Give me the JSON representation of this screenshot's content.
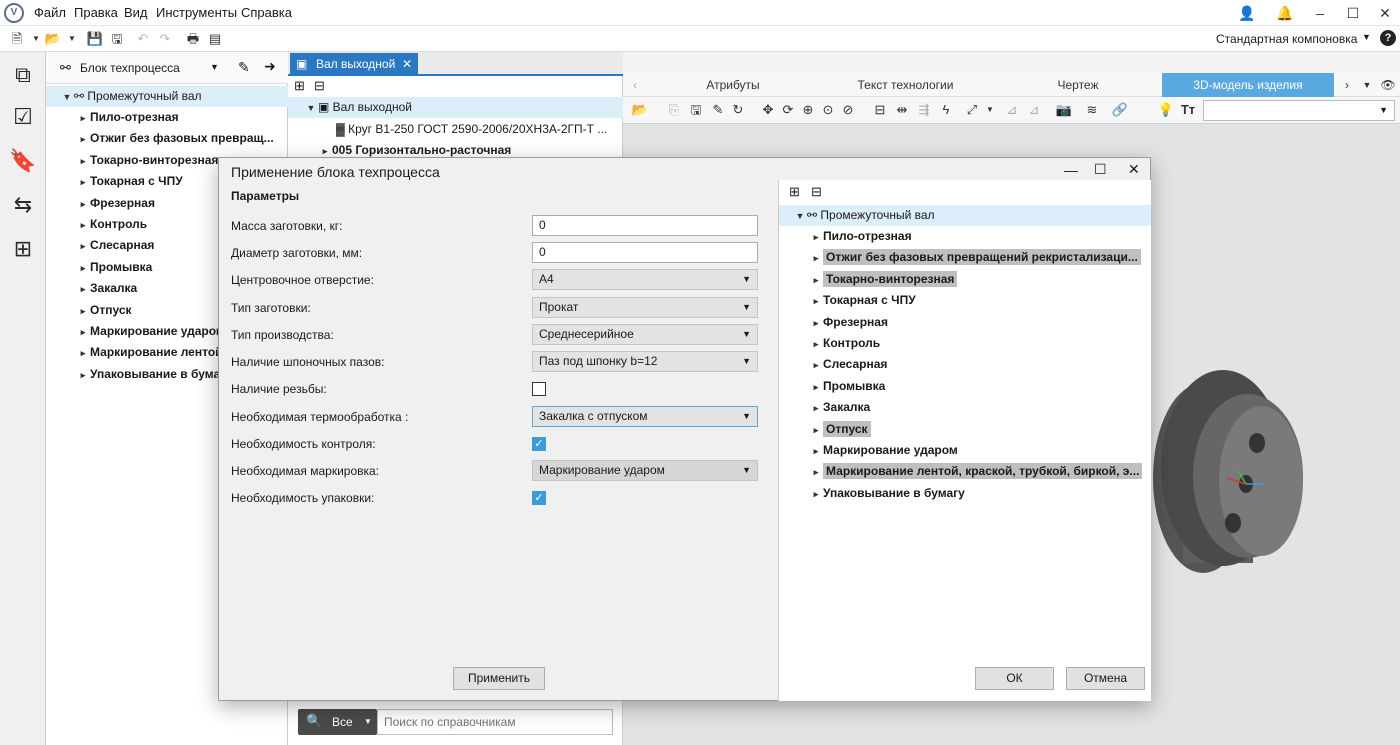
{
  "menu": {
    "file": "Файл",
    "edit": "Правка",
    "view": "Вид",
    "tools": "Инструменты",
    "help": "Справка"
  },
  "layout_selector": "Стандартная компоновка",
  "left_panel": {
    "header": "Блок техпроцесса",
    "root": "Промежуточный вал",
    "items": [
      "Пило-отрезная",
      "Отжиг без фазовых превращ...",
      "Токарно-винторезная",
      "Токарная с ЧПУ",
      "Фрезерная",
      "Контроль",
      "Слесарная",
      "Промывка",
      "Закалка",
      "Отпуск",
      "Маркирование ударом",
      "Маркирование лентой",
      "Упаковывание в бумагу"
    ]
  },
  "middle_panel": {
    "tab": "Вал выходной",
    "root": "Вал выходной",
    "item1": "Круг В1-250 ГОСТ 2590-2006/20ХН3А-2ГП-Т ...",
    "item2": "005 Горизонтально-расточная",
    "search_all": "Все",
    "search_placeholder": "Поиск по справочникам"
  },
  "right_tabs": [
    "Атрибуты",
    "Текст технологии",
    "Чертеж",
    "3D-модель изделия"
  ],
  "dialog": {
    "title": "Применение блока техпроцесса",
    "params_header": "Параметры",
    "mass_label": "Масса заготовки, кг:",
    "mass_value": "0",
    "diameter_label": "Диаметр заготовки, мм:",
    "diameter_value": "0",
    "center_label": "Центровочное отверстие:",
    "center_value": "А4",
    "blank_type_label": "Тип заготовки:",
    "blank_type_value": "Прокат",
    "prod_type_label": "Тип производства:",
    "prod_type_value": "Среднесерийное",
    "keyway_label": "Наличие шпоночных пазов:",
    "keyway_value": "Паз под шпонку b=12",
    "thread_label": "Наличие резьбы:",
    "heat_label": "Необходимая термообработка :",
    "heat_value": "Закалка с отпуском",
    "control_label": "Необходимость контроля:",
    "marking_label": "Необходимая маркировка:",
    "marking_value": "Маркирование ударом",
    "pack_label": "Необходимость упаковки:",
    "apply": "Применить",
    "ok": "ОК",
    "cancel": "Отмена",
    "tree_root": "Промежуточный вал",
    "tree_items": [
      "Пило-отрезная",
      "Отжиг без фазовых превращений рекристализаци...",
      "Токарно-винторезная",
      "Токарная с ЧПУ",
      "Фрезерная",
      "Контроль",
      "Слесарная",
      "Промывка",
      "Закалка",
      "Отпуск",
      "Маркирование ударом",
      "Маркирование лентой, краской, трубкой, биркой, э...",
      "Упаковывание в бумагу"
    ]
  },
  "colors": {
    "accent": "#2b78c2",
    "check": "#3b9cd8",
    "tab_active": "#5aa8e0"
  }
}
